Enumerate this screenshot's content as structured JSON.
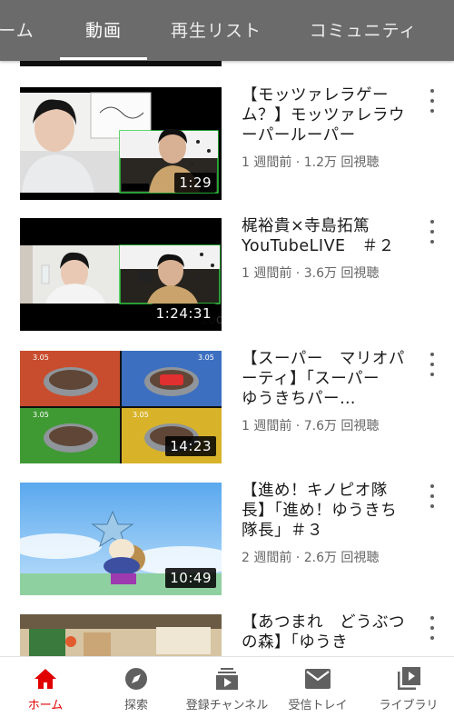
{
  "tabs": [
    {
      "label": "ーム",
      "active": false
    },
    {
      "label": "動画",
      "active": true
    },
    {
      "label": "再生リスト",
      "active": false
    },
    {
      "label": "コミュニティ",
      "active": false
    }
  ],
  "videos": [
    {
      "title": "【モッツァレラゲーム？】モッツァレラウーパールーパー",
      "title_display": "【モッツァレラゲーム？】モッツァレラウーパールーパー",
      "meta": "1 週間前 · 1.2万 回視聴",
      "duration": "1:29"
    },
    {
      "title": "梶裕貴×寺島拓篤 YouTubeLIVE ＃２",
      "title_display": "梶裕貴×寺島拓篤 YouTubeLIVE　＃２",
      "meta": "1 週間前 · 3.6万 回視聴",
      "duration": "1:24:31"
    },
    {
      "title": "【スーパー　マリオパーティ】「スーパー　ゆうきちパー…",
      "title_display": "【スーパー　マリオパーティ】「スーパー　ゆうきちパー…",
      "meta": "1 週間前 · 7.6万 回視聴",
      "duration": "14:23"
    },
    {
      "title": "【進め！キノピオ隊長】「進め！ゆうきち隊長」＃３",
      "title_display": "【進め！キノピオ隊長】「進め！ゆうきち隊長」＃３",
      "meta": "2 週間前 · 2.6万 回視聴",
      "duration": "10:49"
    },
    {
      "title": "【あつまれ　どうぶつの森】「ゆうき",
      "title_display": "【あつまれ　どうぶつの森】「ゆうき",
      "meta": "",
      "duration": ""
    }
  ],
  "nav": [
    {
      "label": "ホーム",
      "icon": "home-icon",
      "active": true
    },
    {
      "label": "探索",
      "icon": "explore-icon",
      "active": false
    },
    {
      "label": "登録チャンネル",
      "icon": "subscriptions-icon",
      "active": false
    },
    {
      "label": "受信トレイ",
      "icon": "inbox-icon",
      "active": false
    },
    {
      "label": "ライブラリ",
      "icon": "library-icon",
      "active": false
    }
  ],
  "colors": {
    "tabbar": "#6b6b6b",
    "accent": "#e10000"
  }
}
